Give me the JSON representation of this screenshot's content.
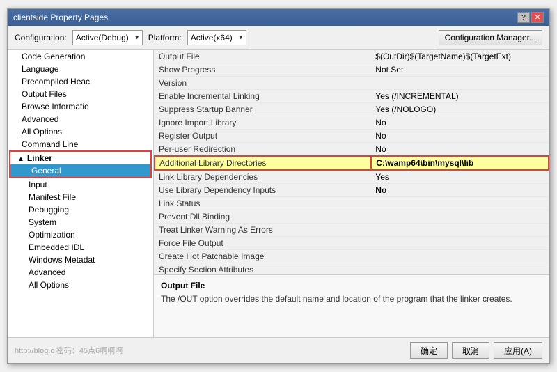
{
  "window": {
    "title": "clientside Property Pages"
  },
  "titleButtons": {
    "help": "?",
    "close": "✕"
  },
  "config": {
    "configLabel": "Configuration:",
    "configValue": "Active(Debug)",
    "platformLabel": "Platform:",
    "platformValue": "Active(x64)",
    "managerBtn": "Configuration Manager..."
  },
  "sidebar": {
    "items": [
      {
        "id": "code-generation",
        "label": "Code Generation",
        "indent": 1
      },
      {
        "id": "language",
        "label": "Language",
        "indent": 1
      },
      {
        "id": "precompiled-headers",
        "label": "Precompiled Heac",
        "indent": 1
      },
      {
        "id": "output-files",
        "label": "Output Files",
        "indent": 1
      },
      {
        "id": "browse-information",
        "label": "Browse Informatio",
        "indent": 1
      },
      {
        "id": "advanced",
        "label": "Advanced",
        "indent": 1
      },
      {
        "id": "all-options",
        "label": "All Options",
        "indent": 1
      },
      {
        "id": "command-line",
        "label": "Command Line",
        "indent": 1
      },
      {
        "id": "linker",
        "label": "Linker",
        "indent": 0,
        "section": true
      },
      {
        "id": "general",
        "label": "General",
        "indent": 2,
        "selected": true
      },
      {
        "id": "input",
        "label": "Input",
        "indent": 2
      },
      {
        "id": "manifest-file",
        "label": "Manifest File",
        "indent": 2
      },
      {
        "id": "debugging",
        "label": "Debugging",
        "indent": 2
      },
      {
        "id": "system",
        "label": "System",
        "indent": 2
      },
      {
        "id": "optimization",
        "label": "Optimization",
        "indent": 2
      },
      {
        "id": "embedded-idl",
        "label": "Embedded IDL",
        "indent": 2
      },
      {
        "id": "windows-metadata",
        "label": "Windows Metadat",
        "indent": 2
      },
      {
        "id": "advanced2",
        "label": "Advanced",
        "indent": 2
      },
      {
        "id": "all-options2",
        "label": "All Options",
        "indent": 2
      }
    ]
  },
  "properties": [
    {
      "name": "Output File",
      "value": "$(OutDir)$(TargetName)$(TargetExt)"
    },
    {
      "name": "Show Progress",
      "value": "Not Set"
    },
    {
      "name": "Version",
      "value": ""
    },
    {
      "name": "Enable Incremental Linking",
      "value": "Yes (/INCREMENTAL)"
    },
    {
      "name": "Suppress Startup Banner",
      "value": "Yes (/NOLOGO)"
    },
    {
      "name": "Ignore Import Library",
      "value": "No"
    },
    {
      "name": "Register Output",
      "value": "No"
    },
    {
      "name": "Per-user Redirection",
      "value": "No"
    },
    {
      "name": "Additional Library Directories",
      "value": "C:\\wamp64\\bin\\mysql\\lib",
      "highlighted": true
    },
    {
      "name": "Link Library Dependencies",
      "value": "Yes"
    },
    {
      "name": "Use Library Dependency Inputs",
      "value": "No",
      "bold": true
    },
    {
      "name": "Link Status",
      "value": ""
    },
    {
      "name": "Prevent Dll Binding",
      "value": ""
    },
    {
      "name": "Treat Linker Warning As Errors",
      "value": ""
    },
    {
      "name": "Force File Output",
      "value": ""
    },
    {
      "name": "Create Hot Patchable Image",
      "value": ""
    },
    {
      "name": "Specify Section Attributes",
      "value": ""
    }
  ],
  "description": {
    "title": "Output File",
    "text": "The /OUT option overrides the default name and location of the program that the linker creates."
  },
  "buttons": {
    "ok": "确定",
    "cancel": "取消",
    "apply": "应用(A)"
  },
  "watermark": "http://blog.c  密码：45点6啊啊啊"
}
